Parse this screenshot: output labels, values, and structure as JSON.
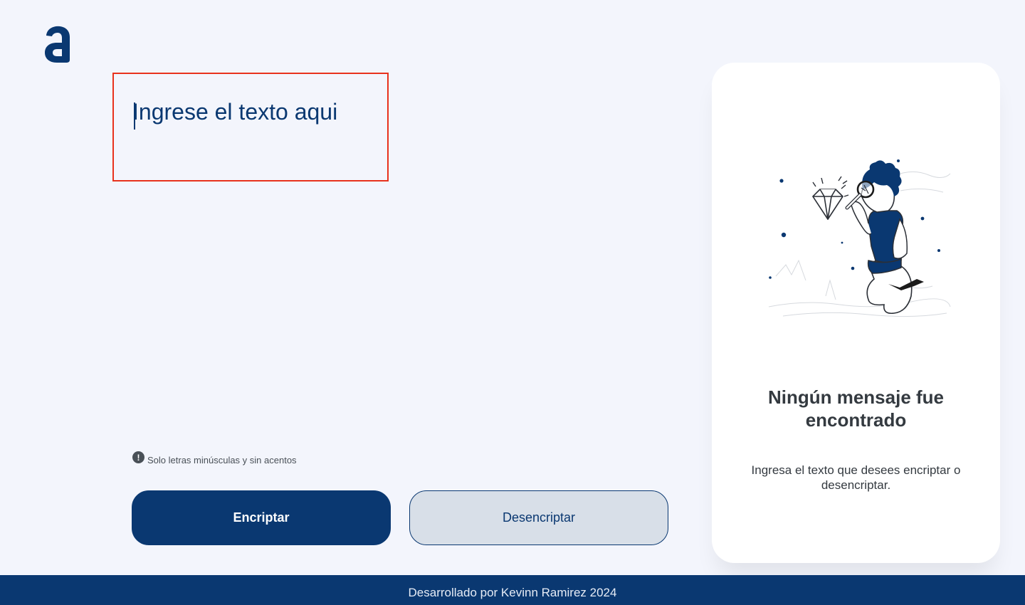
{
  "logo": {
    "icon": "alura-logo-icon"
  },
  "editor": {
    "placeholder": "Ingrese el texto aqui",
    "value": ""
  },
  "hint": {
    "icon": "exclamation-circle-icon",
    "icon_glyph": "!",
    "text": "Solo letras minúsculas y sin acentos"
  },
  "buttons": {
    "encrypt_label": "Encriptar",
    "decrypt_label": "Desencriptar"
  },
  "result": {
    "illustration": "person-with-magnifying-glass-illustration",
    "title": "Ningún mensaje fue encontrado",
    "subtitle": "Ingresa el texto que desees encriptar o desencriptar."
  },
  "footer": {
    "text": "Desarrollado por Kevinn Ramirez 2024"
  },
  "colors": {
    "primary": "#0a3871",
    "background": "#f3f5fc",
    "highlight_border": "#e8321c",
    "secondary_button": "#d8dfe8",
    "text_dark": "#343a40"
  }
}
